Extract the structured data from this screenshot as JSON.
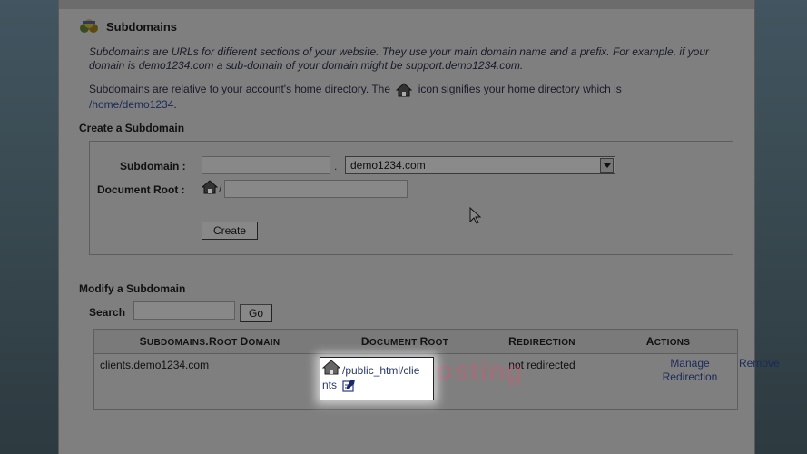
{
  "section": {
    "title": "Subdomains",
    "description": "Subdomains are URLs for different sections of your website. They use your main domain name and a prefix. For example, if your domain is demo1234.com a sub-domain of your domain might be support.demo1234.com.",
    "relative_note_before": "Subdomains are relative to your account's home directory. The",
    "relative_note_after": "icon signifies your home directory which is",
    "home_dir": "/home/demo1234",
    "home_dir_suffix": "."
  },
  "create": {
    "heading": "Create a Subdomain",
    "subdomain_label": "Subdomain :",
    "subdomain_value": "",
    "dot": ".",
    "domain_selected": "demo1234.com",
    "docroot_label": "Document Root :",
    "docroot_prefix": "/",
    "docroot_value": "",
    "create_button": "Create"
  },
  "modify": {
    "heading": "Modify a Subdomain",
    "search_label": "Search",
    "search_value": "",
    "go_button": "Go",
    "columns": {
      "col1_big": "S",
      "col1_small": "UBDOMAINS",
      "col1_dot": ".",
      "col1_big2": "R",
      "col1_small2": "OOT ",
      "col1_big3": "D",
      "col1_small3": "OMAIN",
      "col2_big": "D",
      "col2_small": "OCUMENT ",
      "col2_big2": "R",
      "col2_small2": "OOT",
      "col3_big": "R",
      "col3_small": "EDIRECTION",
      "col4_big": "A",
      "col4_small": "CTIONS"
    },
    "rows": [
      {
        "subdomain": "clients.demo1234.com",
        "docroot_line1": "/public_html/clie",
        "docroot_line2": "nts",
        "redirection": "not redirected",
        "manage_link": "Manage Redirection",
        "remove_link": "Remove"
      }
    ]
  },
  "watermark": "SkyNetHosting",
  "colors": {
    "page_bg": "#7f7f7f",
    "highlight_bg": "#ffffff",
    "link": "#1a2a5a"
  }
}
